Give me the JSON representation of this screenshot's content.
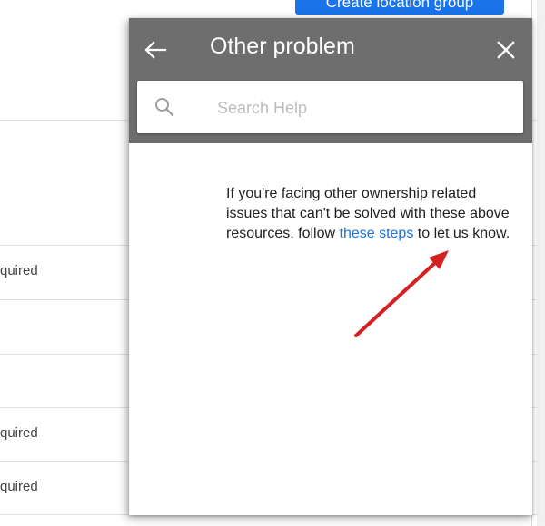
{
  "background": {
    "create_button_label": "Create location group",
    "row_fragments": [
      "quired",
      "quired",
      "quired"
    ]
  },
  "help_panel": {
    "title": "Other problem",
    "search": {
      "placeholder": "Search Help",
      "value": ""
    },
    "article": {
      "text_before_link": "If you're facing other ownership related issues that can't be solved with these above resources, follow ",
      "link_text": "these steps",
      "text_after_link": " to let us know."
    }
  },
  "colors": {
    "header_bg": "#6e6e6e",
    "link": "#1a73e8",
    "annotation_arrow": "#d32020",
    "primary_button": "#1a73e8"
  },
  "icons": {
    "back": "arrow-left-icon",
    "close": "close-icon",
    "search": "search-icon"
  }
}
